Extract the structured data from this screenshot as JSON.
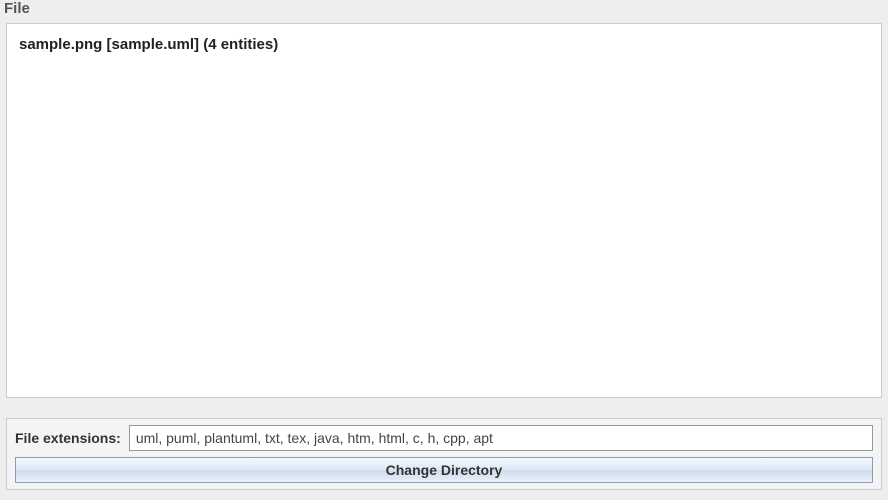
{
  "header": {
    "title": "File"
  },
  "file_list": {
    "items": [
      {
        "label": "sample.png [sample.uml] (4 entities)"
      }
    ]
  },
  "footer": {
    "extensions_label": "File extensions:",
    "extensions_value": "uml, puml, plantuml, txt, tex, java, htm, html, c, h, cpp, apt",
    "change_dir_label": "Change Directory"
  }
}
